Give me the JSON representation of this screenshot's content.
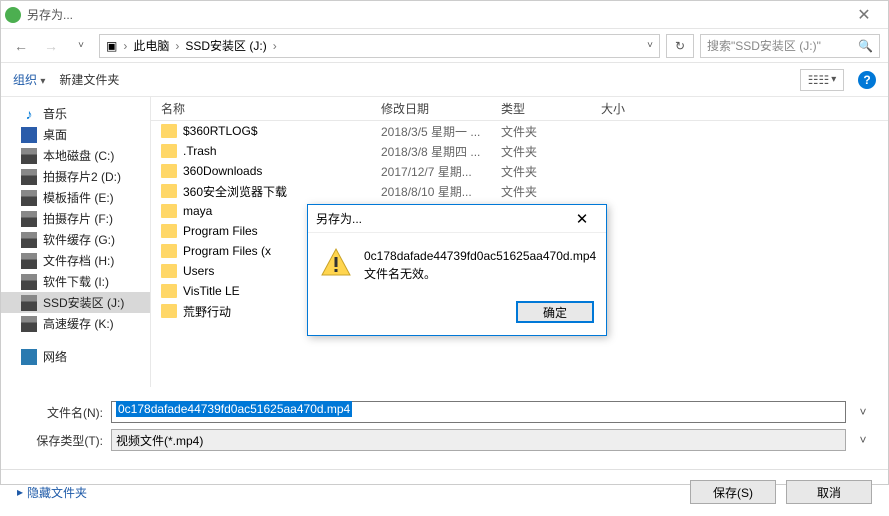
{
  "window": {
    "title": "另存为..."
  },
  "nav": {
    "breadcrumb": [
      "此电脑",
      "SSD安装区 (J:)"
    ],
    "search_placeholder": "搜索\"SSD安装区 (J:)\""
  },
  "toolbar": {
    "organize": "组织",
    "organize_arrow": "▾",
    "new_folder": "新建文件夹",
    "view_label": "☷☷",
    "view_arrow": "▾",
    "help": "?"
  },
  "tree": {
    "items": [
      {
        "icon": "music",
        "label": "音乐"
      },
      {
        "icon": "desktop",
        "label": "桌面"
      },
      {
        "icon": "drive",
        "label": "本地磁盘 (C:)"
      },
      {
        "icon": "drive",
        "label": "拍摄存片2 (D:)"
      },
      {
        "icon": "drive",
        "label": "模板插件 (E:)"
      },
      {
        "icon": "drive",
        "label": "拍摄存片 (F:)"
      },
      {
        "icon": "drive",
        "label": "软件缓存 (G:)"
      },
      {
        "icon": "drive",
        "label": "文件存档 (H:)"
      },
      {
        "icon": "drive",
        "label": "软件下载 (I:)"
      },
      {
        "icon": "drive",
        "label": "SSD安装区 (J:)",
        "selected": true
      },
      {
        "icon": "drive",
        "label": "高速缓存 (K:)"
      },
      {
        "icon": "network",
        "label": "网络"
      }
    ]
  },
  "list": {
    "headers": {
      "name": "名称",
      "date": "修改日期",
      "type": "类型",
      "size": "大小"
    },
    "rows": [
      {
        "name": "$360RTLOG$",
        "date": "2018/3/5 星期一 ...",
        "type": "文件夹"
      },
      {
        "name": ".Trash",
        "date": "2018/3/8 星期四 ...",
        "type": "文件夹"
      },
      {
        "name": "360Downloads",
        "date": "2017/12/7 星期...",
        "type": "文件夹"
      },
      {
        "name": "360安全浏览器下载",
        "date": "2018/8/10 星期...",
        "type": "文件夹"
      },
      {
        "name": "maya",
        "date": "",
        "type": ""
      },
      {
        "name": "Program Files",
        "date": "",
        "type": ""
      },
      {
        "name": "Program Files (x",
        "date": "",
        "type": ""
      },
      {
        "name": "Users",
        "date": "",
        "type": ""
      },
      {
        "name": "VisTitle LE",
        "date": "",
        "type": ""
      },
      {
        "name": "荒野行动",
        "date": "",
        "type": ""
      }
    ]
  },
  "form": {
    "filename_label": "文件名(N):",
    "filename_value": "0c178dafade44739fd0ac51625aa470d.mp4",
    "filetype_label": "保存类型(T):",
    "filetype_value": "视频文件(*.mp4)"
  },
  "actions": {
    "hide": "隐藏文件夹",
    "save": "保存(S)",
    "cancel": "取消"
  },
  "dialog": {
    "title": "另存为...",
    "line1": "0c178dafade44739fd0ac51625aa470d.mp4",
    "line2": "文件名无效。",
    "ok": "确定"
  },
  "glyphs": {
    "back": "←",
    "fwd": "→",
    "chev": "›",
    "pc": "▣",
    "down": "˅",
    "refresh": "↻",
    "mag": "🔍",
    "tri": "▸",
    "close": "✕"
  }
}
